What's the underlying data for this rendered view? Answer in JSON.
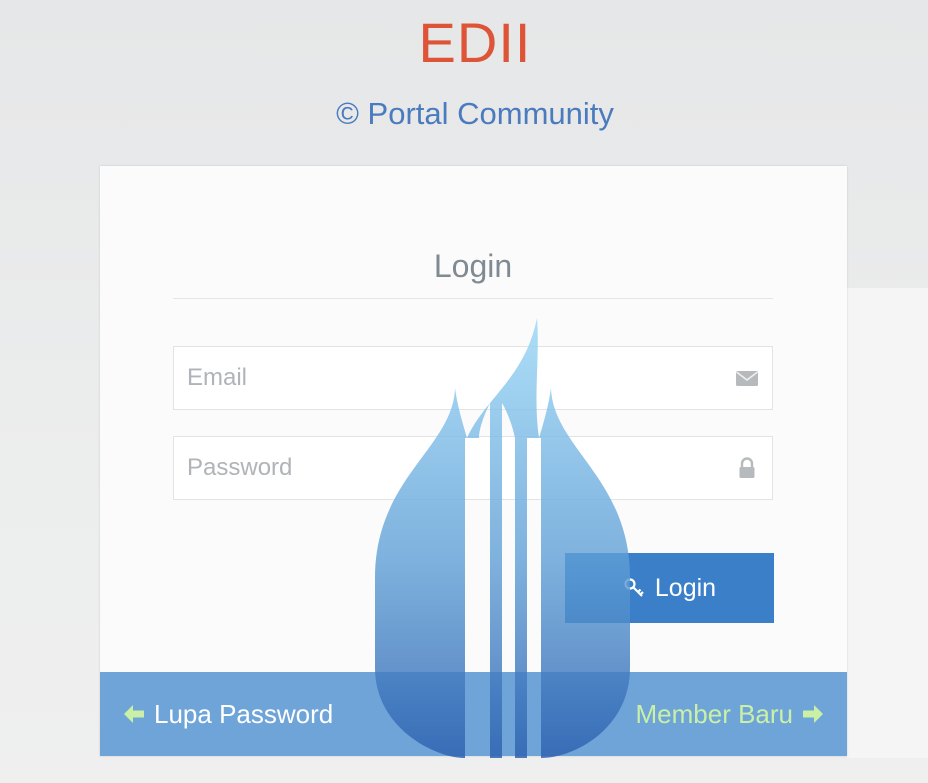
{
  "header": {
    "brand": "EDII",
    "subtitle": "© Portal Community"
  },
  "login_card": {
    "title": "Login",
    "email": {
      "placeholder": "Email",
      "value": "",
      "icon": "envelope-icon"
    },
    "password": {
      "placeholder": "Password",
      "value": "",
      "icon": "lock-icon"
    },
    "submit": {
      "label": "Login",
      "icon": "key-icon"
    }
  },
  "footer": {
    "forgot_password": {
      "label": "Lupa Password",
      "icon": "arrow-left-icon"
    },
    "new_member": {
      "label": "Member Baru",
      "icon": "arrow-right-icon"
    }
  },
  "colors": {
    "brand": "#dd5436",
    "subtitle": "#4a7bbf",
    "button": "#3a7fc8",
    "footer_bar": "#6fa4d9",
    "new_member_text": "#c9f0a6"
  }
}
